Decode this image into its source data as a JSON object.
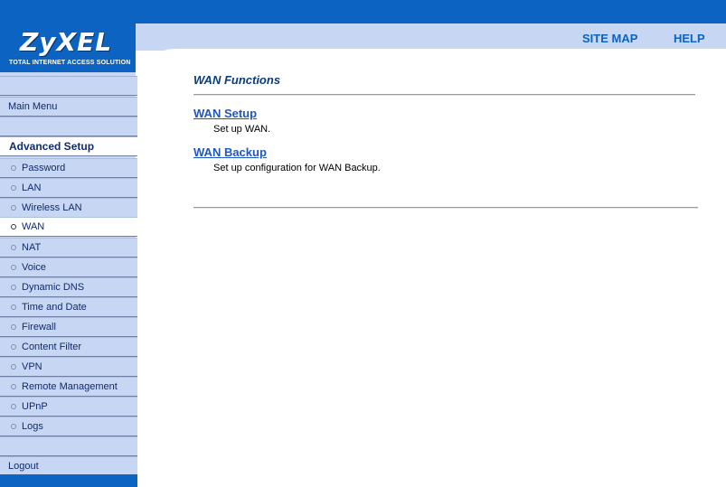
{
  "brand": {
    "name": "ZyXEL",
    "tagline": "TOTAL INTERNET ACCESS SOLUTION"
  },
  "top_links": {
    "site_map": "SITE MAP",
    "help": "HELP"
  },
  "sidebar": {
    "main_menu": "Main Menu",
    "advanced_setup": "Advanced Setup",
    "items": [
      {
        "label": "Password"
      },
      {
        "label": "LAN"
      },
      {
        "label": "Wireless LAN"
      },
      {
        "label": "WAN"
      },
      {
        "label": "NAT"
      },
      {
        "label": "Voice"
      },
      {
        "label": "Dynamic DNS"
      },
      {
        "label": "Time and Date"
      },
      {
        "label": "Firewall"
      },
      {
        "label": "Content Filter"
      },
      {
        "label": "VPN"
      },
      {
        "label": "Remote Management"
      },
      {
        "label": "UPnP"
      },
      {
        "label": "Logs"
      }
    ],
    "active_item": "WAN",
    "logout": "Logout"
  },
  "main": {
    "title": "WAN Functions",
    "functions": [
      {
        "link": "WAN Setup",
        "description": "Set up WAN."
      },
      {
        "link": "WAN Backup",
        "description": "Set up configuration for WAN Backup."
      }
    ]
  },
  "colors": {
    "header_blue": "#0c63c2",
    "sidebar_bg": "#c7d6f2",
    "link_blue": "#1e56c4",
    "title_blue": "#0a3d7a"
  }
}
